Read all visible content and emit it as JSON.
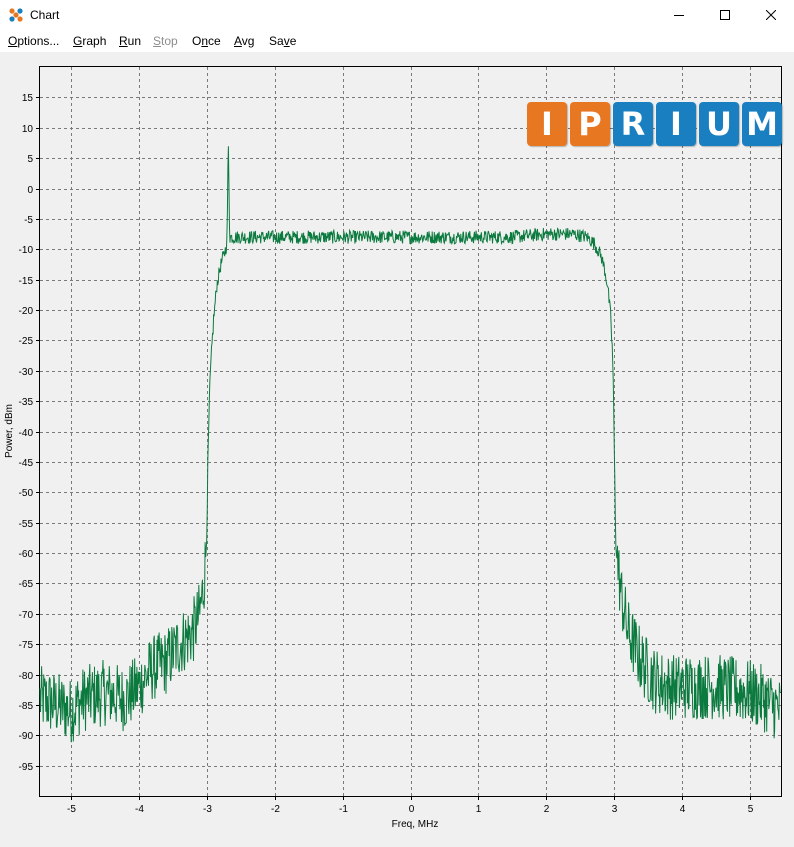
{
  "window": {
    "title": "Chart",
    "icon": "app-dots-icon",
    "controls": [
      "minimize-icon",
      "maximize-icon",
      "close-icon"
    ]
  },
  "menu": [
    {
      "label": "Options...",
      "underline_index": 0,
      "enabled": true
    },
    {
      "label": "Graph",
      "underline_index": 0,
      "enabled": true
    },
    {
      "label": "Run",
      "underline_index": 0,
      "enabled": true
    },
    {
      "label": "Stop",
      "underline_index": 0,
      "enabled": false
    },
    {
      "label": "Once",
      "underline_index": 1,
      "enabled": true
    },
    {
      "label": "Avg",
      "underline_index": 0,
      "enabled": true
    },
    {
      "label": "Save",
      "underline_index": 2,
      "enabled": true
    }
  ],
  "logo": {
    "letters": [
      "I",
      "P",
      "R",
      "I",
      "U",
      "M"
    ],
    "colors": [
      "#e87722",
      "#e87722",
      "#1a7fc1",
      "#1a7fc1",
      "#1a7fc1",
      "#1a7fc1"
    ]
  },
  "colors": {
    "trace": "#0b7a3e",
    "plot_background": "#f0f0f0",
    "grid": "#7a7a7a"
  },
  "chart_data": {
    "type": "line",
    "title": "",
    "xlabel": "Freq, MHz",
    "ylabel": "Power, dBm",
    "xlim": [
      -5.45,
      5.45
    ],
    "ylim": [
      -100,
      20
    ],
    "x_ticks": [
      -5,
      -4,
      -3,
      -2,
      -1,
      0,
      1,
      2,
      3,
      4,
      5
    ],
    "y_ticks": [
      15,
      10,
      5,
      0,
      -5,
      -10,
      -15,
      -20,
      -25,
      -30,
      -35,
      -40,
      -45,
      -50,
      -55,
      -60,
      -65,
      -70,
      -75,
      -80,
      -85,
      -90,
      -95
    ],
    "grid": true,
    "legend": "none",
    "series": [
      {
        "x": [
          -5.45,
          -5.2,
          -5.0,
          -4.8,
          -4.5,
          -4.2,
          -4.0,
          -3.8,
          -3.6,
          -3.4,
          -3.2,
          -3.1,
          -3.05,
          -3.02,
          -3.0,
          -2.98,
          -2.95,
          -2.9,
          -2.85,
          -2.8,
          -2.75,
          -2.72,
          -2.7,
          -2.68,
          -2.66,
          -2.6,
          -2.4,
          -2.0,
          -1.5,
          -1.0,
          -0.5,
          0.0,
          0.5,
          1.0,
          1.5,
          2.0,
          2.4,
          2.6,
          2.7,
          2.75,
          2.8,
          2.85,
          2.9,
          2.95,
          2.98,
          3.0,
          3.02,
          3.05,
          3.1,
          3.2,
          3.4,
          3.6,
          3.8,
          4.0,
          4.5,
          5.0,
          5.2,
          5.45
        ],
        "y": [
          -84,
          -85,
          -86,
          -84,
          -83,
          -84,
          -82,
          -79,
          -78,
          -75,
          -73,
          -70,
          -66,
          -62,
          -58,
          -45,
          -32,
          -22,
          -16,
          -13,
          -11,
          -10,
          -9,
          8,
          -8,
          -8,
          -8,
          -8,
          -8,
          -8,
          -8,
          -8,
          -8,
          -8,
          -8,
          -7.5,
          -7.5,
          -8,
          -9,
          -10,
          -11,
          -13,
          -16,
          -22,
          -30,
          -45,
          -58,
          -62,
          -67,
          -73,
          -78,
          -81,
          -82,
          -82,
          -82,
          -83,
          -84,
          -86
        ]
      }
    ]
  }
}
